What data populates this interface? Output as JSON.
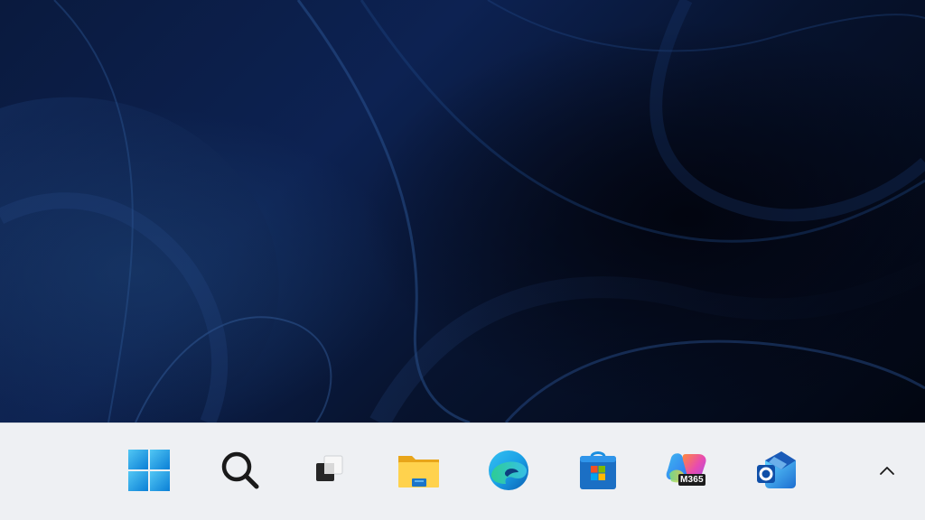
{
  "desktop": {
    "wallpaper": "windows-11-bloom-dark-blue"
  },
  "taskbar": {
    "background": "#eef0f3",
    "items": [
      {
        "name": "start",
        "icon": "windows-logo-icon"
      },
      {
        "name": "search",
        "icon": "search-icon"
      },
      {
        "name": "task-view",
        "icon": "task-view-icon"
      },
      {
        "name": "file-explorer",
        "icon": "folder-icon"
      },
      {
        "name": "edge",
        "icon": "edge-browser-icon"
      },
      {
        "name": "microsoft-store",
        "icon": "store-bag-icon"
      },
      {
        "name": "m365-copilot",
        "icon": "m365-copilot-icon",
        "badge": "M365"
      },
      {
        "name": "outlook",
        "icon": "outlook-icon"
      }
    ],
    "tray": {
      "chevron": "chevron-up-icon"
    }
  }
}
